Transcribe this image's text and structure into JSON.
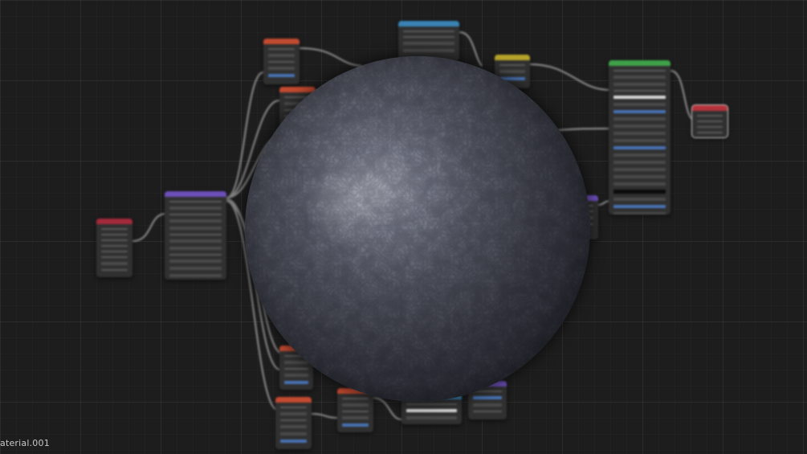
{
  "material": {
    "label": "aterial.001"
  },
  "colors": {
    "background": "#1d1d1d",
    "node_body": "#303030",
    "header_texture": "#c24a30",
    "header_input": "#a22a3a",
    "header_vector": "#6c4fb8",
    "header_converter": "#3a83b5",
    "header_color": "#b5a22a",
    "header_shader": "#3fa24a",
    "header_output": "#b5333b",
    "wire": "#8a8a8a"
  },
  "icons": {
    "sphere": "material-preview-sphere"
  }
}
